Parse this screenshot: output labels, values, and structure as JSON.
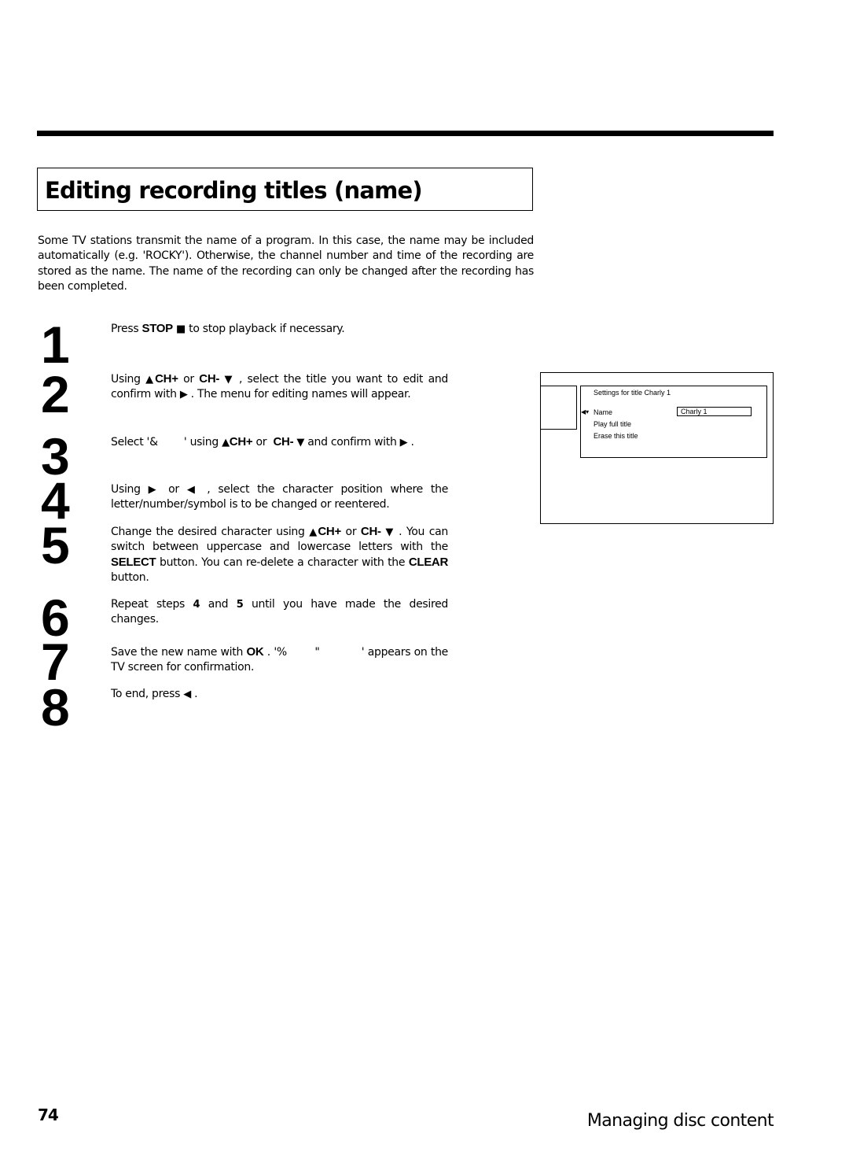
{
  "page": {
    "title": "Editing recording titles (name)",
    "intro": "Some TV stations transmit the name of a program. In this case, the name may be included automatically (e.g. 'ROCKY'). Otherwise, the channel number and time of the recording are stored as the name. The name of the recording can only be changed after the recording has been completed.",
    "page_number": "74",
    "section": "Managing disc content"
  },
  "symbols": {
    "stop": "■",
    "up": "▲",
    "down": "▼",
    "right": "▶",
    "left": "◀"
  },
  "steps": [
    {
      "num": "1",
      "a": "Press ",
      "k1": "STOP",
      "b": " to stop playback if necessary."
    },
    {
      "num": "2",
      "a": "Using ",
      "k1": "CH+",
      "b": " or ",
      "k2": "CH-",
      "c": " , select the title you want to edit and confirm with ",
      "d": " . The menu for editing names will appear."
    },
    {
      "num": "3",
      "a": "Select '&        ' using ",
      "k1": "CH+",
      "b": " or ",
      "k2": "CH-",
      "c": " and confirm with ",
      "d": " ."
    },
    {
      "num": "4",
      "a": "Using ",
      "b": " or ",
      "c": " , select the character position where the letter/number/symbol is to be changed or reentered."
    },
    {
      "num": "5",
      "a": "Change the desired character using ",
      "k1": "CH+",
      "b": " or ",
      "k2": "CH-",
      "c": " . You can switch between uppercase and lowercase letters with the ",
      "k3": "SELECT",
      "d": " button. You can re-delete a character with the ",
      "k4": "CLEAR",
      "e": " button."
    },
    {
      "num": "6",
      "a": "Repeat steps ",
      "k1": "4",
      "b": " and ",
      "k2": "5",
      "c": " until you have made the desired changes."
    },
    {
      "num": "7",
      "a": "Save the new name with ",
      "k1": "OK",
      "b": " . '%        \"            ' appears on the TV screen for confirmation."
    },
    {
      "num": "8",
      "a": "To end, press ",
      "b": " ."
    }
  ],
  "tv_screen": {
    "header": "Settings for title Charly 1",
    "cursor": "◀▾",
    "items": [
      "Name",
      "Play full title",
      "Erase this title"
    ],
    "name_value": "Charly 1"
  }
}
